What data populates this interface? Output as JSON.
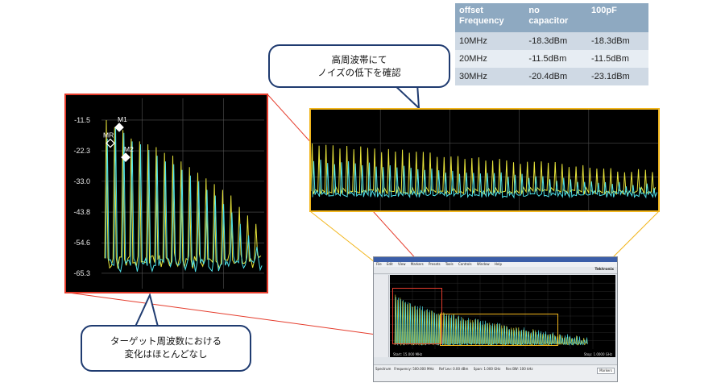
{
  "table": {
    "headers": [
      "offset\nFrequency",
      "no\ncapacitor",
      "100pF"
    ],
    "rows": [
      [
        "10MHz",
        "-18.3dBm",
        "-18.3dBm"
      ],
      [
        "20MHz",
        "-11.5dBm",
        "-11.5dBm"
      ],
      [
        "30MHz",
        "-20.4dBm",
        "-23.1dBm"
      ]
    ]
  },
  "callouts": {
    "top": "高周波帯にて\nノイズの低下を確認",
    "bottom": "ターゲット周波数における\n変化はほとんどなし"
  },
  "colors": {
    "trace_no_capacitor": "#e8e43a",
    "trace_100pF": "#4fe0e8",
    "left_frame": "#e53c2c",
    "right_frame": "#f2b61d",
    "callout_border": "#1f3b70",
    "table_header": "#8ea9c1"
  },
  "chart_data": {
    "type": "line",
    "yticks": [
      "-11.5",
      "-22.3",
      "-33.0",
      "-43.8",
      "-54.6",
      "-65.3"
    ],
    "ylim": [
      -69,
      -5
    ],
    "grid": true,
    "markers": [
      {
        "label": "M1",
        "value": -11.5
      },
      {
        "label": "MR",
        "value": -16.5
      },
      {
        "label": "M2",
        "value": -22.3
      }
    ],
    "series": [
      {
        "color": "yellow",
        "noise_floor": -62,
        "peak_values": [
          -11.5,
          -14,
          -15,
          -18,
          -19,
          -20,
          -21,
          -23,
          -24,
          -26,
          -28,
          -30,
          -32,
          -34,
          -36,
          -38,
          -42,
          -45,
          -48
        ]
      },
      {
        "color": "cyan",
        "noise_floor": -63,
        "peak_values": [
          -18,
          -14,
          -16,
          -19,
          -20,
          -22,
          -24,
          -26,
          -27,
          -29,
          -31,
          -33,
          -36,
          -38,
          -41,
          -44,
          -48,
          -52,
          -56
        ]
      }
    ]
  },
  "analyzer": {
    "brand": "Tektronix",
    "menu": [
      "File",
      "Edit",
      "View",
      "Markers",
      "Presets",
      "Tools",
      "Controls",
      "Window",
      "Help"
    ],
    "start": "Start: 15.000 MHz",
    "stop": "Stop: 1.0000 GHz",
    "spectrum": "Spectrum",
    "frequency": "Frequency: 500.000 MHz",
    "ref_lev": "Ref Lev: 0.00 dBm",
    "span": "Span: 1.000 GHz",
    "res_bw": "Res BW: 100 kHz",
    "markers_btn": "Markers"
  }
}
